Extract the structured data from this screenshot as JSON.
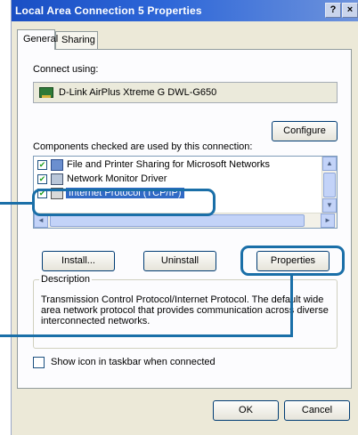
{
  "window": {
    "title": "Local Area Connection 5 Properties",
    "help_label": "?",
    "close_label": "×"
  },
  "tabs": [
    {
      "label": "General",
      "active": true
    },
    {
      "label": "Sharing",
      "active": false
    }
  ],
  "connect_using": {
    "label": "Connect using:",
    "adapter_name": "D-Link AirPlus Xtreme G DWL-G650",
    "configure_label": "Configure"
  },
  "components": {
    "label": "Components checked are used by this connection:",
    "items": [
      {
        "label": "File and Printer Sharing for Microsoft Networks",
        "checked": true,
        "icon": "share-icon"
      },
      {
        "label": "Network Monitor Driver",
        "checked": true,
        "icon": "monitor-icon"
      },
      {
        "label": "Internet Protocol (TCP/IP)",
        "checked": true,
        "icon": "protocol-icon",
        "selected": true
      }
    ],
    "check_mark": "✔"
  },
  "buttons": {
    "install": "Install...",
    "uninstall": "Uninstall",
    "properties": "Properties",
    "ok": "OK",
    "cancel": "Cancel"
  },
  "scroll_arrows": {
    "up": "▲",
    "down": "▼",
    "left": "◄",
    "right": "►"
  },
  "description": {
    "legend": "Description",
    "text": "Transmission Control Protocol/Internet Protocol. The default wide area network protocol that provides communication across diverse interconnected networks."
  },
  "show_icon": {
    "label": "Show icon in taskbar when connected",
    "checked": false
  },
  "colors": {
    "title_bar": "#1a4fc4",
    "selection": "#316ac5",
    "callout": "#1a6fa8",
    "dialog_bg": "#ece9d8"
  }
}
